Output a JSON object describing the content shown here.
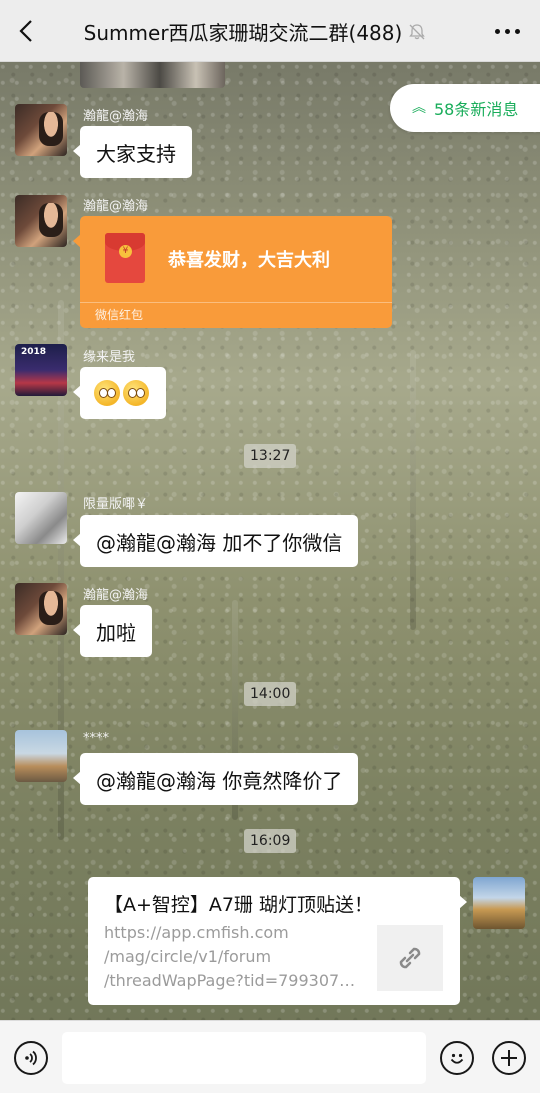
{
  "header": {
    "title": "Summer西瓜家珊瑚交流二群(488)"
  },
  "new_messages": {
    "label": "58条新消息"
  },
  "messages": [
    {
      "sender": "瀚龍@瀚海",
      "text": "大家支持"
    },
    {
      "sender": "瀚龍@瀚海",
      "red_packet_text": "恭喜发财，大吉大利",
      "red_packet_label": "微信红包"
    },
    {
      "sender": "缘来是我",
      "avatar_text": "2018",
      "emoji": [
        "dizzy-face",
        "dizzy-face"
      ]
    },
    {
      "time": "13:27"
    },
    {
      "sender": "限量版㖿￥",
      "text": "@瀚龍@瀚海  加不了你微信"
    },
    {
      "sender": "瀚龍@瀚海",
      "text": "加啦"
    },
    {
      "time": "14:00"
    },
    {
      "sender": "****",
      "text": "@瀚龍@瀚海  你竟然降价了"
    },
    {
      "time": "16:09"
    },
    {
      "link_title": "【A+智控】A7珊 瑚灯顶贴送！",
      "link_url_lines": [
        "https://app.cmfish.com",
        "/mag/circle/v1/forum",
        "/threadWapPage?tid=799307…"
      ]
    }
  ],
  "colors": {
    "accent_green": "#1aad5b",
    "red_packet": "#f99b3a",
    "bubble": "#ffffff"
  }
}
